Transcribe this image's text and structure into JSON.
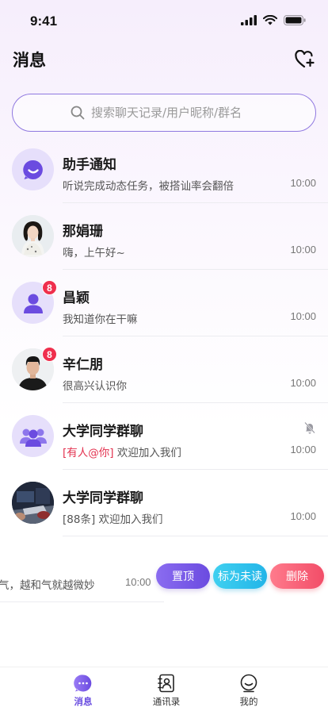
{
  "status_bar": {
    "time": "9:41"
  },
  "header": {
    "title": "消息"
  },
  "search": {
    "placeholder": "搜索聊天记录/用户昵称/群名"
  },
  "conversations": [
    {
      "name": "助手通知",
      "preview": "听说完成动态任务，被搭讪率会翻倍",
      "time": "10:00",
      "avatar": "assistant-icon"
    },
    {
      "name": "那娟珊",
      "preview": "嗨，上午好~",
      "time": "10:00",
      "avatar": "photo-girl"
    },
    {
      "name": "昌颖",
      "preview": "我知道你在干嘛",
      "time": "10:00",
      "badge": "8",
      "avatar": "default-user-icon"
    },
    {
      "name": "辛仁朋",
      "preview": "很高兴认识你",
      "time": "10:00",
      "badge": "8",
      "avatar": "photo-boy"
    },
    {
      "name": "大学同学群聊",
      "mention": "[有人@你]",
      "preview": " 欢迎加入我们",
      "time": "10:00",
      "muted": true,
      "avatar": "group-icon"
    },
    {
      "name": "大学同学群聊",
      "preview": "[88条] 欢迎加入我们",
      "time": "10:00",
      "avatar": "photo-group"
    }
  ],
  "swiped_row": {
    "preview": "气，越和气就越微妙",
    "time": "10:00",
    "actions": {
      "pin": "置顶",
      "mark_unread": "标为未读",
      "delete": "删除"
    }
  },
  "tabbar": {
    "messages": "消息",
    "contacts": "通讯录",
    "me": "我的"
  },
  "colors": {
    "accent": "#6a4de0",
    "badge": "#ef2f4d",
    "mention": "#e3324f"
  }
}
